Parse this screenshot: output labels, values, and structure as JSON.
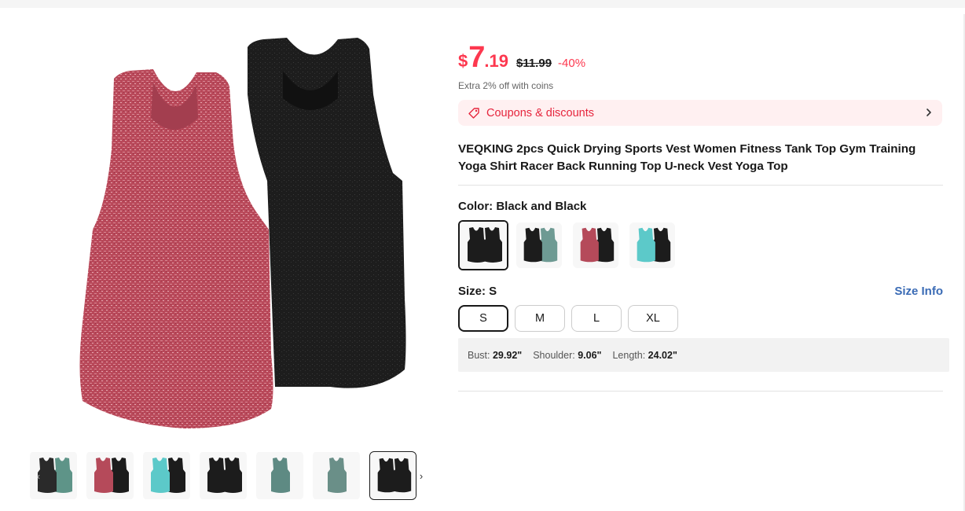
{
  "price": {
    "currency": "$",
    "integer": "7",
    "decimal": ".19",
    "original": "$11.99",
    "discount": "-40%"
  },
  "extra_offer": "Extra 2% off with coins",
  "coupons": {
    "label": "Coupons & discounts"
  },
  "product": {
    "title": "VEQKING 2pcs Quick Drying Sports Vest Women Fitness Tank Top Gym Training Yoga Shirt Racer Back Running Top U-neck Vest Yoga Top"
  },
  "color": {
    "label": "Color: Black and Black",
    "options": [
      {
        "name": "Black and Black",
        "selected": true,
        "left": "#1c1c1c",
        "right": "#1c1c1c"
      },
      {
        "name": "Black and Gray Green",
        "selected": false,
        "left": "#1c1c1c",
        "right": "#6e9a93"
      },
      {
        "name": "Red and Black",
        "selected": false,
        "left": "#b54a5a",
        "right": "#1c1c1c"
      },
      {
        "name": "Blue and Black",
        "selected": false,
        "left": "#5cc9c9",
        "right": "#1c1c1c"
      }
    ]
  },
  "size": {
    "label": "Size: S",
    "info_link": "Size Info",
    "options": [
      {
        "label": "S",
        "selected": true
      },
      {
        "label": "M",
        "selected": false
      },
      {
        "label": "L",
        "selected": false
      },
      {
        "label": "XL",
        "selected": false
      }
    ]
  },
  "measurements": [
    {
      "name": "Bust:",
      "value": "29.92\""
    },
    {
      "name": "Shoulder:",
      "value": "9.06\""
    },
    {
      "name": "Length:",
      "value": "24.02\""
    }
  ],
  "thumbnails": [
    {
      "left": "#2a2a2a",
      "right": "#5e9488",
      "selected": false
    },
    {
      "left": "#b54a5a",
      "right": "#1c1c1c",
      "selected": false
    },
    {
      "left": "#5cc9c9",
      "right": "#1c1c1c",
      "selected": false
    },
    {
      "left": "#1c1c1c",
      "right": "#1c1c1c",
      "selected": false
    },
    {
      "left": "#5e8a83",
      "right": null,
      "selected": false
    },
    {
      "left": "#6a8f88",
      "right": null,
      "selected": false
    },
    {
      "left": "#1c1c1c",
      "right": "#1c1c1c",
      "selected": true
    }
  ],
  "icons": {
    "coupon": "tag-icon",
    "coupon_arrow": "chevron-right-icon",
    "thumbs_next": "chevron-right-icon",
    "thumbs_prev": "chevron-left-icon"
  },
  "colors": {
    "accent_red": "#fd384f",
    "link_blue": "#3a6bb5",
    "coupon_bg": "#fff0f1"
  }
}
